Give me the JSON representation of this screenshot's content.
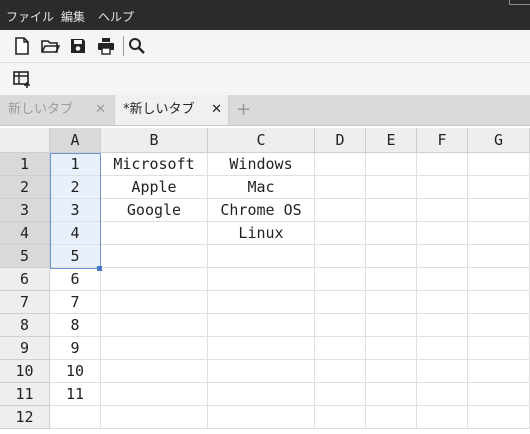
{
  "menubar": {
    "file": "ファイル",
    "edit": "編集",
    "help": "ヘルプ"
  },
  "toolbar": {
    "icons": [
      "new-file-icon",
      "open-folder-icon",
      "save-icon",
      "print-icon",
      "search-icon"
    ],
    "row2_icons": [
      "table-insert-icon"
    ]
  },
  "tabs": [
    {
      "label": "新しいタブ",
      "close": "✕",
      "active": false
    },
    {
      "label": "*新しいタブ",
      "close": "✕",
      "active": true
    }
  ],
  "add_tab": "+",
  "sheet": {
    "columns": [
      "A",
      "B",
      "C",
      "D",
      "E",
      "F",
      "G"
    ],
    "rows": [
      "1",
      "2",
      "3",
      "4",
      "5",
      "6",
      "7",
      "8",
      "9",
      "10",
      "11",
      "12"
    ],
    "cells": [
      [
        "1",
        "Microsoft",
        "Windows",
        "",
        "",
        "",
        ""
      ],
      [
        "2",
        "Apple",
        "Mac",
        "",
        "",
        "",
        ""
      ],
      [
        "3",
        "Google",
        "Chrome OS",
        "",
        "",
        "",
        ""
      ],
      [
        "4",
        "",
        "Linux",
        "",
        "",
        "",
        ""
      ],
      [
        "5",
        "",
        "",
        "",
        "",
        "",
        ""
      ],
      [
        "6",
        "",
        "",
        "",
        "",
        "",
        ""
      ],
      [
        "7",
        "",
        "",
        "",
        "",
        "",
        ""
      ],
      [
        "8",
        "",
        "",
        "",
        "",
        "",
        ""
      ],
      [
        "9",
        "",
        "",
        "",
        "",
        "",
        ""
      ],
      [
        "10",
        "",
        "",
        "",
        "",
        "",
        ""
      ],
      [
        "11",
        "",
        "",
        "",
        "",
        "",
        ""
      ],
      [
        "",
        "",
        "",
        "",
        "",
        "",
        ""
      ]
    ]
  },
  "colors": {
    "menubar_bg": "#2b2b2b",
    "selection_border": "#6b94d6",
    "selection_fill": "#e8f0fb"
  }
}
